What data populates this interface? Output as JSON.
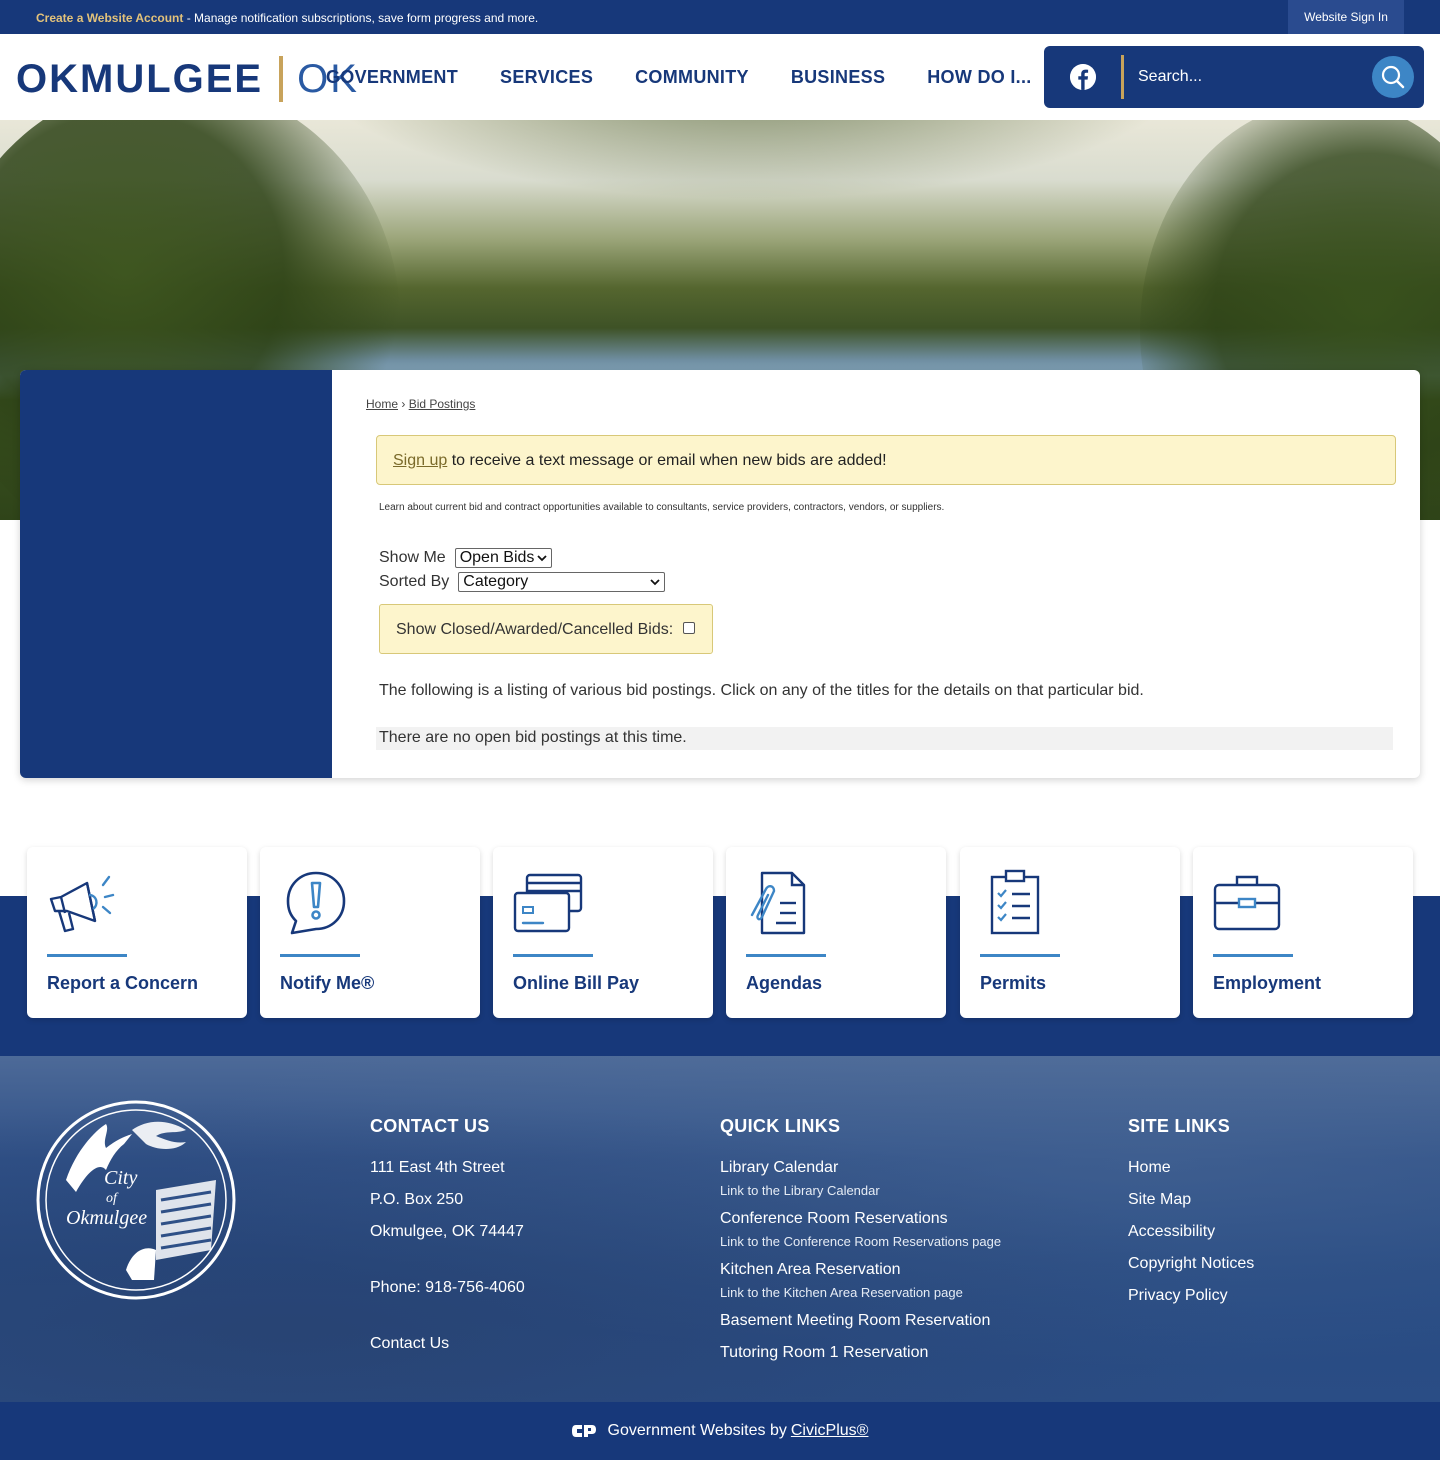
{
  "topbar": {
    "account_link": "Create a Website Account",
    "account_desc": " - Manage notification subscriptions, save form progress and more.",
    "sign_in": "Website Sign In"
  },
  "header": {
    "logo_city": "OKMULGEE",
    "logo_state": "OK",
    "nav": [
      "GOVERNMENT",
      "SERVICES",
      "COMMUNITY",
      "BUSINESS",
      "HOW DO I..."
    ],
    "search_placeholder": "Search...",
    "facebook_icon": "facebook-icon",
    "search_icon": "search-icon"
  },
  "breadcrumb": {
    "home": "Home",
    "sep": " › ",
    "current": "Bid Postings"
  },
  "alert": {
    "link": "Sign up",
    "text": " to receive a text message or email when new bids are added!"
  },
  "intro": "Learn about current bid and contract opportunities available to consultants, service providers, contractors, vendors, or suppliers.",
  "filters": {
    "show_me_label": "Show Me",
    "show_me_value": "Open Bids",
    "sorted_by_label": "Sorted By",
    "sorted_by_value": "Category",
    "closed_label": "Show Closed/Awarded/Cancelled Bids:"
  },
  "listing_text": "The following is a listing of various bid postings. Click on any of the titles for the details on that particular bid.",
  "no_bids": "There are no open bid postings at this time.",
  "tiles": [
    {
      "label": "Report a Concern",
      "icon": "megaphone-icon"
    },
    {
      "label": "Notify Me®",
      "icon": "notification-bubble-icon"
    },
    {
      "label": "Online Bill Pay",
      "icon": "credit-card-icon"
    },
    {
      "label": "Agendas",
      "icon": "document-clip-icon"
    },
    {
      "label": "Permits",
      "icon": "clipboard-checklist-icon"
    },
    {
      "label": "Employment",
      "icon": "briefcase-icon"
    }
  ],
  "footer": {
    "seal_text": [
      "City",
      "of",
      "Okmulgee"
    ],
    "contact": {
      "title": "CONTACT US",
      "street": "111 East 4th Street",
      "po": "P.O. Box 250",
      "city": "Okmulgee, OK 74447",
      "phone": "Phone: 918-756-4060",
      "contact_link": "Contact Us"
    },
    "quick_links": {
      "title": "QUICK LINKS",
      "items": [
        {
          "label": "Library Calendar",
          "desc": "Link to the Library Calendar"
        },
        {
          "label": "Conference Room Reservations",
          "desc": "Link to the Conference Room Reservations page"
        },
        {
          "label": "Kitchen Area Reservation",
          "desc": "Link to the Kitchen Area Reservation page"
        },
        {
          "label": "Basement Meeting Room Reservation",
          "desc": ""
        },
        {
          "label": "Tutoring Room 1 Reservation",
          "desc": ""
        }
      ]
    },
    "site_links": {
      "title": "SITE LINKS",
      "items": [
        "Home",
        "Site Map",
        "Accessibility",
        "Copyright Notices",
        "Privacy Policy"
      ]
    }
  },
  "bottom": {
    "text": "Government Websites by",
    "link": "CivicPlus®"
  },
  "colors": {
    "navy": "#17387a",
    "gold": "#c8a35b",
    "accent_blue": "#3d86c6",
    "alert_bg": "#fdf5cc"
  }
}
